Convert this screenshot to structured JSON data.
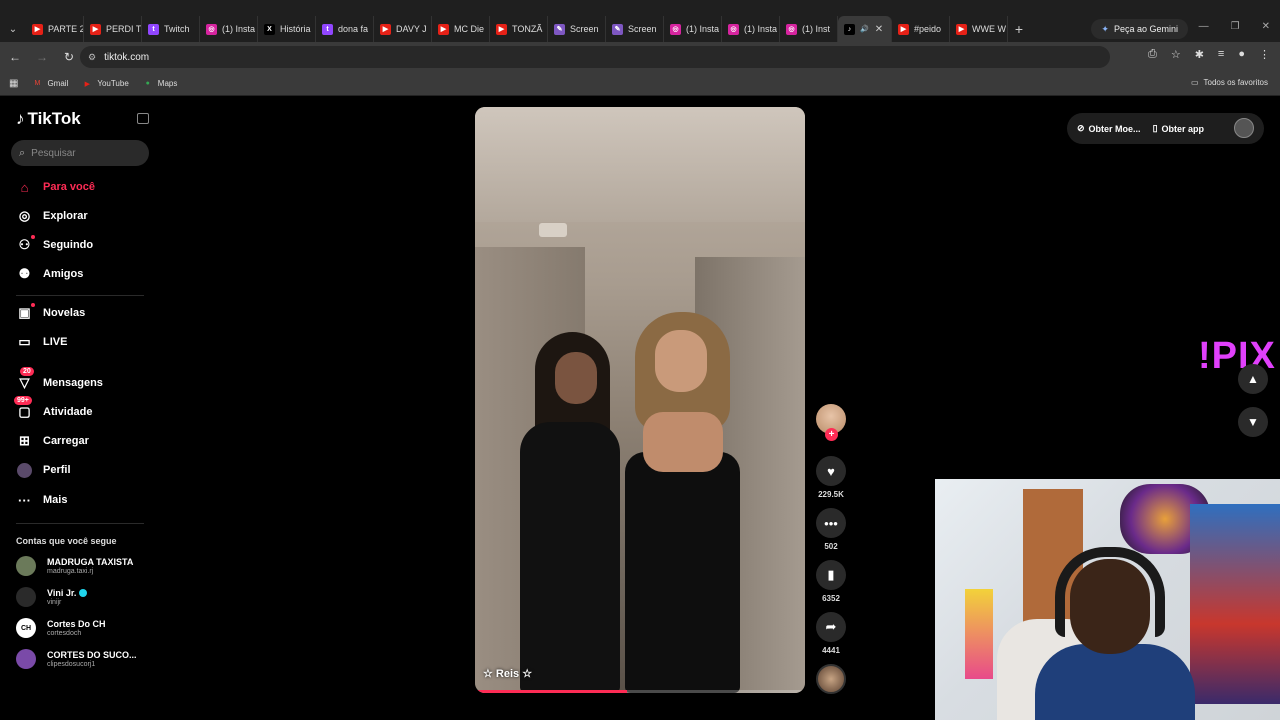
{
  "browser": {
    "tabs": [
      {
        "label": "PARTE 2",
        "color": "#e62117",
        "glyph": "▶"
      },
      {
        "label": "PERDI T",
        "color": "#e62117",
        "glyph": "▶"
      },
      {
        "label": "Twitch",
        "color": "#9146ff",
        "glyph": "t"
      },
      {
        "label": "(1) Insta",
        "color": "#d6249f",
        "glyph": "◎"
      },
      {
        "label": "História",
        "color": "#000000",
        "glyph": "X"
      },
      {
        "label": "dona fa",
        "color": "#9146ff",
        "glyph": "t"
      },
      {
        "label": "DAVY J",
        "color": "#e62117",
        "glyph": "▶"
      },
      {
        "label": "MC Die",
        "color": "#e62117",
        "glyph": "▶"
      },
      {
        "label": "TONZÃ",
        "color": "#e62117",
        "glyph": "▶"
      },
      {
        "label": "Screen",
        "color": "#7e57c2",
        "glyph": "✎"
      },
      {
        "label": "Screen",
        "color": "#7e57c2",
        "glyph": "✎"
      },
      {
        "label": "(1) Insta",
        "color": "#d6249f",
        "glyph": "◎"
      },
      {
        "label": "(1) Insta",
        "color": "#d6249f",
        "glyph": "◎"
      },
      {
        "label": "(1) Inst",
        "color": "#d6249f",
        "glyph": "◎"
      },
      {
        "label": "",
        "color": "#000000",
        "glyph": "♪",
        "active": true
      },
      {
        "label": "#peido",
        "color": "#e62117",
        "glyph": "▶"
      },
      {
        "label": "WWE W",
        "color": "#e62117",
        "glyph": "▶"
      }
    ],
    "gemini_label": "Peça ao Gemini",
    "url": "tiktok.com",
    "bookmarks": [
      {
        "label": "Gmail",
        "color": "#ea4335",
        "glyph": "M"
      },
      {
        "label": "YouTube",
        "color": "#e62117",
        "glyph": "▶"
      },
      {
        "label": "Maps",
        "color": "#34a853",
        "glyph": "●"
      }
    ],
    "all_bookmarks_label": "Todos os favoritos"
  },
  "tiktok": {
    "logo": "TikTok",
    "search_placeholder": "Pesquisar",
    "nav": {
      "for_you": "Para você",
      "explore": "Explorar",
      "following": "Seguindo",
      "friends": "Amigos",
      "novelas": "Novelas",
      "live": "LIVE",
      "messages": "Mensagens",
      "messages_badge": "20",
      "activity": "Atividade",
      "activity_badge": "99+",
      "upload": "Carregar",
      "profile": "Perfil",
      "more": "Mais"
    },
    "following_title": "Contas que você segue",
    "following_accounts": [
      {
        "name": "MADRUGA TAXISTA",
        "user": "madruga.taxi.rj",
        "color": "#6b7a5a",
        "initials": ""
      },
      {
        "name": "Vini Jr.",
        "user": "vinijr",
        "color": "#2a2a2a",
        "initials": "",
        "verified": true
      },
      {
        "name": "Cortes Do CH",
        "user": "cortesdoch",
        "color": "#ffffff",
        "initials": "CH"
      },
      {
        "name": "CORTES DO SUCO...",
        "user": "clipesdosucorj1",
        "color": "#7a4aa8",
        "initials": ""
      }
    ],
    "video": {
      "caption": "☆ Reis ☆",
      "progress": 0.46
    },
    "actions": {
      "likes": "229.5K",
      "comments": "502",
      "saves": "6352",
      "shares": "4441"
    },
    "top": {
      "coins_label": "Obter Moe...",
      "app_label": "Obter app"
    },
    "overlay_text": "!PIX"
  }
}
